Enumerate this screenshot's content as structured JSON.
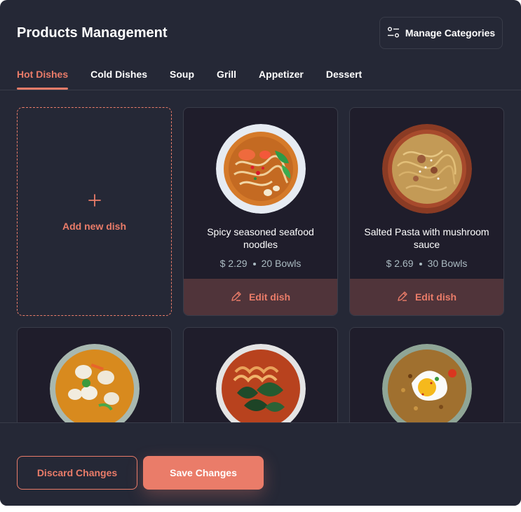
{
  "header": {
    "title": "Products Management",
    "manage_label": "Manage Categories",
    "manage_icon": "options-icon"
  },
  "tabs": [
    {
      "label": "Hot Dishes",
      "active": true
    },
    {
      "label": "Cold Dishes"
    },
    {
      "label": "Soup"
    },
    {
      "label": "Grill"
    },
    {
      "label": "Appetizer"
    },
    {
      "label": "Dessert"
    }
  ],
  "add_card": {
    "icon": "plus-icon",
    "label": "Add new dish"
  },
  "dishes": [
    {
      "name": "Spicy seasoned seafood noodles",
      "price": "$ 2.29",
      "stock": "20 Bowls",
      "edit_label": "Edit dish"
    },
    {
      "name": "Salted Pasta with mushroom sauce",
      "price": "$ 2.69",
      "stock": "30 Bowls",
      "edit_label": "Edit dish"
    },
    {
      "name": "",
      "price": "",
      "stock": ""
    },
    {
      "name": "",
      "price": "",
      "stock": ""
    },
    {
      "name": "",
      "price": "",
      "stock": ""
    }
  ],
  "footer": {
    "discard_label": "Discard Changes",
    "save_label": "Save Changes"
  },
  "colors": {
    "accent": "#ea7c69",
    "background": "#252836",
    "card": "#1f1d2b",
    "border": "#393c49"
  }
}
